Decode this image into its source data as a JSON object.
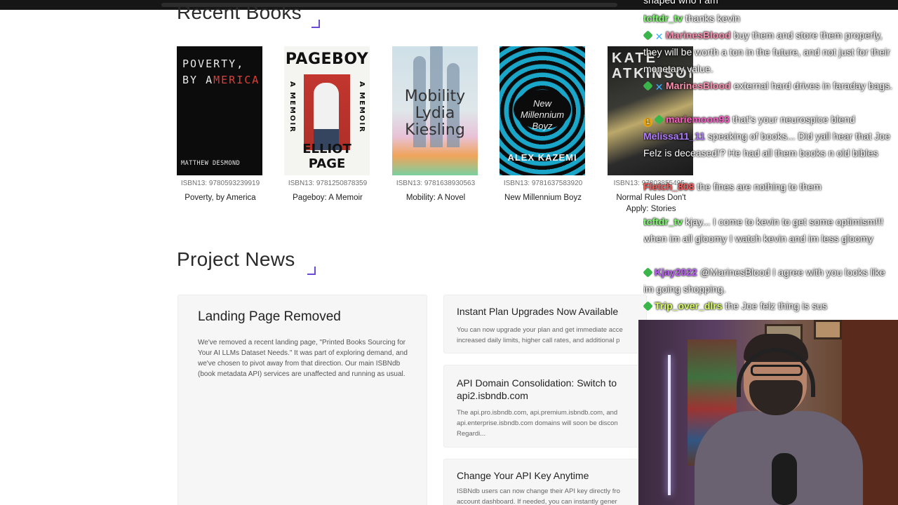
{
  "sections": {
    "recent_books": "Recent Books",
    "project_news": "Project News"
  },
  "books": [
    {
      "isbn": "ISBN13: 9780593239919",
      "title": "Poverty, by America",
      "cover_title_line1": "POVERTY,",
      "cover_title_line2a": "BY A",
      "cover_title_line2b": "MERICA",
      "cover_author": "MATTHEW DESMOND"
    },
    {
      "isbn": "ISBN13: 9781250878359",
      "title": "Pageboy: A Memoir",
      "cover_title": "PAGEBOY",
      "cover_side": "A MEMOIR",
      "cover_author": "ELLIOT PAGE"
    },
    {
      "isbn": "ISBN13: 9781638930563",
      "title": "Mobility: A Novel",
      "cover_title_line1": "Mobility",
      "cover_title_line2": "Lydia",
      "cover_title_line3": "Kiesling"
    },
    {
      "isbn": "ISBN13: 9781637583920",
      "title": "New Millennium Boyz",
      "cover_title": "New Millennium Boyz",
      "cover_author": "ALEX KAZEMI"
    },
    {
      "isbn": "ISBN13: 97803855495..",
      "title": "Normal Rules Don't Apply: Stories",
      "cover_author_line1": "KATE",
      "cover_author_line2": "ATKINSON"
    }
  ],
  "news": {
    "featured": {
      "title": "Landing Page Removed",
      "body": "We've removed a recent landing page, \"Printed Books Sourcing for Your AI LLMs Dataset Needs.\" It was part of exploring demand, and we've chosen to pivot away from that direction. Our main ISBNdb (book metadata API) services are unaffected and running as usual."
    },
    "cards": [
      {
        "title": "Instant Plan Upgrades Now Available",
        "line1": "You can now upgrade your plan and get immediate acce",
        "line2": "increased daily limits, higher call rates, and additional p"
      },
      {
        "title_line1": "API Domain Consolidation: Switch to",
        "title_line2": "api2.isbndb.com",
        "line1": "The api.pro.isbndb.com, api.premium.isbndb.com, and",
        "line2": "api.enterprise.isbndb.com domains will soon be discon",
        "line3": "Regardi..."
      },
      {
        "title": "Change Your API Key Anytime",
        "line1": "ISBNdb users can now change their API key directly fro",
        "line2": "account dashboard. If needed, you can instantly gener"
      }
    ]
  },
  "chat": [
    {
      "user": "",
      "text": "shaped who I am",
      "color": "#ffffff"
    },
    {
      "user": "tcftdr_tv",
      "text": "thanks kevin",
      "color": "#7cff6b"
    },
    {
      "user": "MarinesBlood",
      "text": "buy them and store them properly, they will be worth a ton in the future, and not just for their monetary value.",
      "color": "#ff8fb0"
    },
    {
      "user": "MarinesBlood",
      "text": "external hard drives in faraday bags.",
      "color": "#ff8fb0"
    },
    {
      "user": "mariemoon93",
      "text": "that's your neurospice blend",
      "color": "#ff5cc8"
    },
    {
      "user": "Melissa11_11",
      "text": "speaking of books... Did yall hear that Joe Felz is deceased!? He had all them books n old bibles",
      "color": "#b07cff"
    },
    {
      "user": "Fletch_808",
      "text": "the fines are nothing to them",
      "color": "#ff5a5a"
    },
    {
      "user": "tcftdr_tv",
      "text": "kjay... I come to kevin to get some optimism!!! when im all gloomy I watch kevin and im less gloomy",
      "color": "#7cff6b"
    },
    {
      "user": "Kjay2022",
      "text": "@MarinesBlood I agree with you looks like im going shopping.",
      "color": "#c05cff"
    },
    {
      "user": "Trip_over_dlrs",
      "text": "the Joe felz thing is sus",
      "color": "#d8ff5c"
    }
  ],
  "colors": {
    "accent": "#6a4bd6",
    "card_bg": "#f6f6f6"
  }
}
